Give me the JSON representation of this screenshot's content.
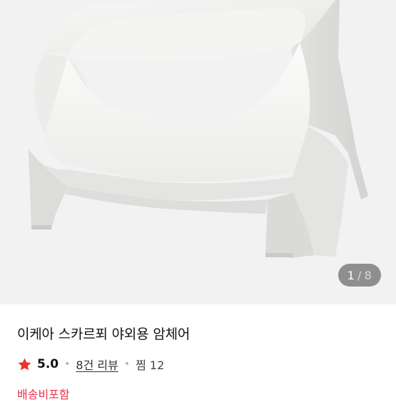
{
  "gallery": {
    "current": "1",
    "separator": "/",
    "total": "8"
  },
  "product": {
    "title": "이케아 스카르푀 야외용 암체어",
    "rating": "5.0",
    "reviews_link": "8건 리뷰",
    "likes": "찜 12",
    "shipping": "배송비포함"
  },
  "colors": {
    "hero_bg": "#f2f2f2",
    "star": "#e8342c",
    "shipping_text": "#e8344e"
  },
  "icons": {
    "rating_icon": "star-icon"
  }
}
